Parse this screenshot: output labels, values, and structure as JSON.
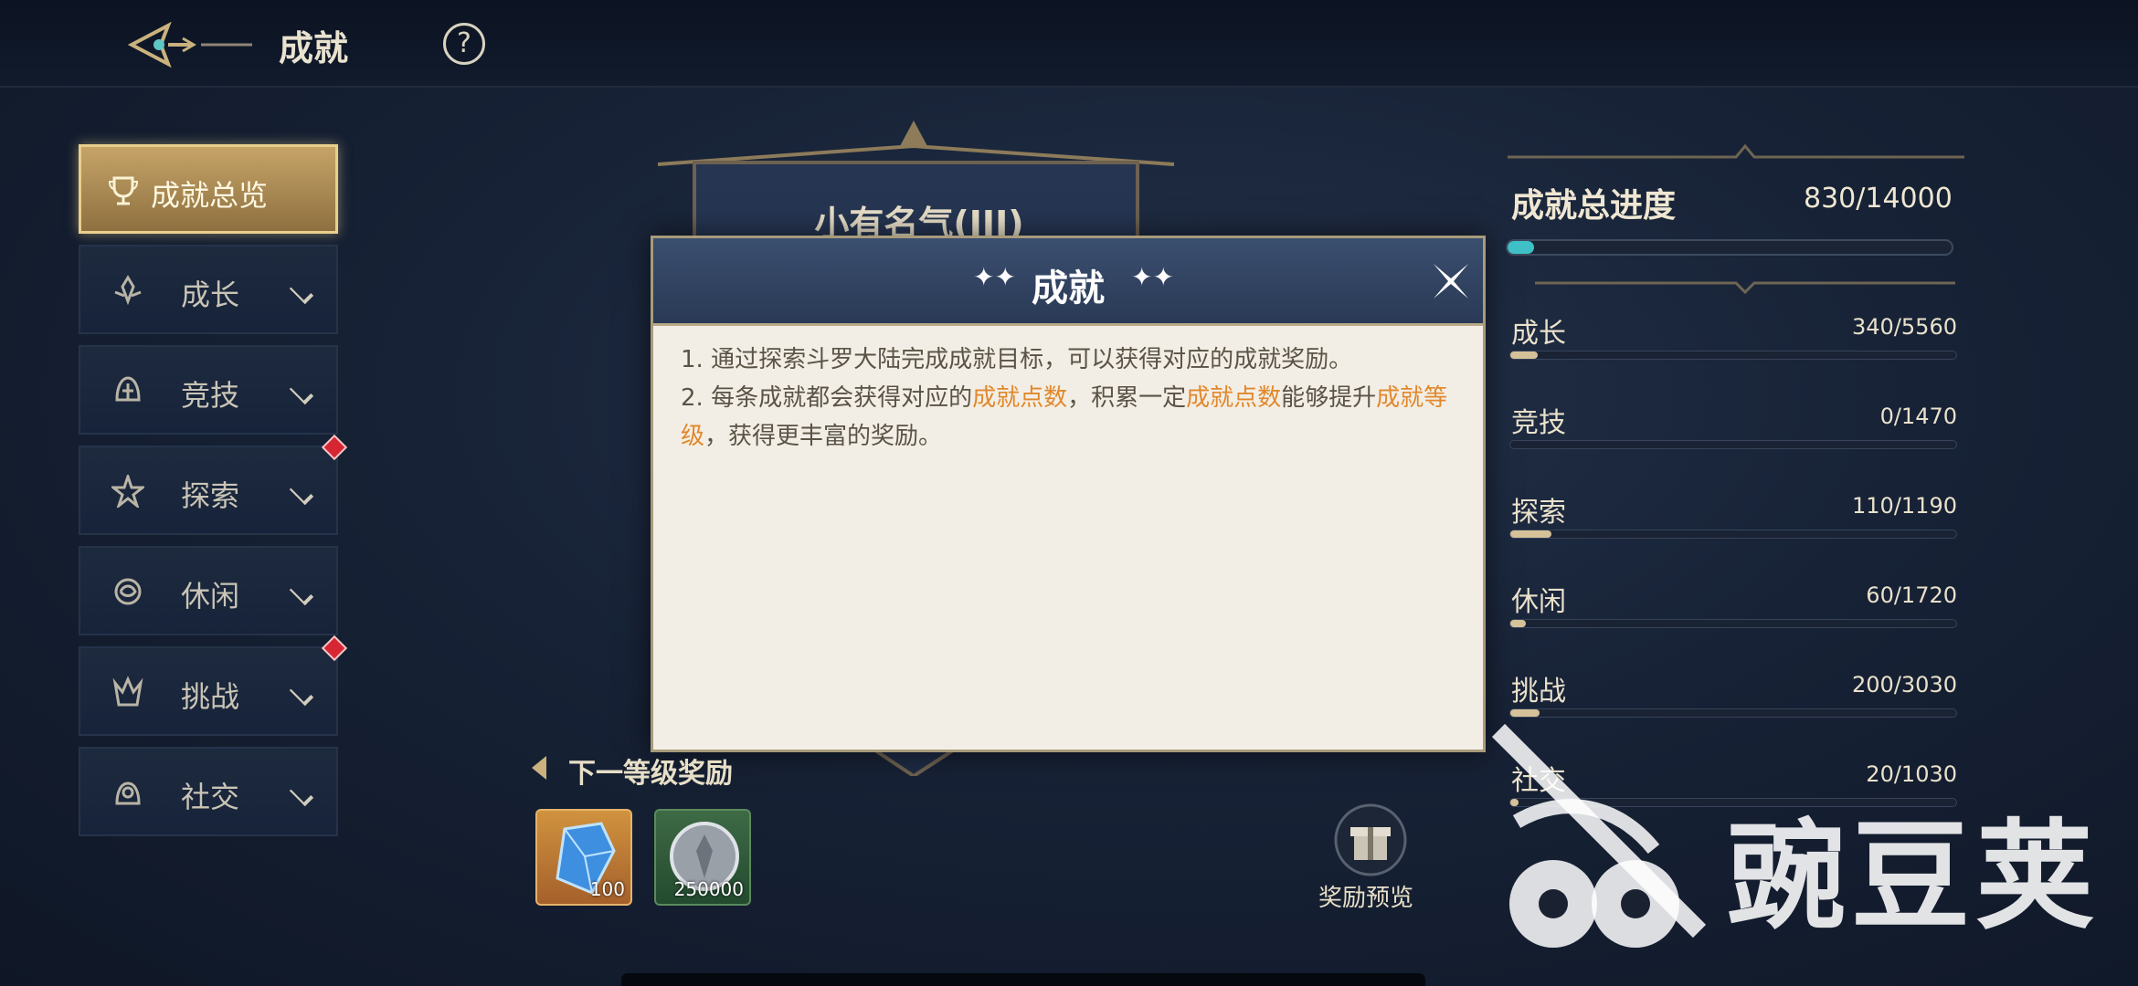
{
  "header": {
    "title": "成就",
    "help_icon": "question-circle-icon",
    "back_icon": "ornate-back-arrow-icon"
  },
  "sidebar": {
    "items": [
      {
        "label": "成就总览",
        "icon": "trophy-icon",
        "active": true,
        "badge": false
      },
      {
        "label": "成长",
        "icon": "sprout-icon",
        "active": false,
        "badge": false
      },
      {
        "label": "竞技",
        "icon": "helmet-icon",
        "active": false,
        "badge": false
      },
      {
        "label": "探索",
        "icon": "compass-star-icon",
        "active": false,
        "badge": true
      },
      {
        "label": "休闲",
        "icon": "leisure-icon",
        "active": false,
        "badge": false
      },
      {
        "label": "挑战",
        "icon": "flame-crest-icon",
        "active": false,
        "badge": true
      },
      {
        "label": "社交",
        "icon": "handshake-icon",
        "active": false,
        "badge": false
      }
    ]
  },
  "banner": {
    "title": "小有名气(III)"
  },
  "dialog": {
    "title": "成就",
    "line1": "1. 通过探索斗罗大陆完成成就目标，可以获得对应的成就奖励。",
    "line2_a": "2. 每条成就都会获得对应的",
    "line2_hl1": "成就点数",
    "line2_b": "，积累一定",
    "line2_hl2": "成就点数",
    "line2_c": "能够提升",
    "line2_hl3": "成就等级",
    "line2_d": "，获得更丰富的奖励。",
    "highlight_color": "#e1882c"
  },
  "rewards": {
    "title": "下一等级奖励",
    "items": [
      {
        "icon": "blue-crystal-icon",
        "count": "100"
      },
      {
        "icon": "silver-coin-icon",
        "count": "250000"
      }
    ],
    "preview_label": "奖励预览",
    "preview_icon": "gift-box-icon"
  },
  "progress": {
    "overall_label": "成就总进度",
    "overall_value": "830/14000",
    "overall_fraction": 0.059,
    "categories": [
      {
        "name": "成长",
        "value": "340/5560",
        "fraction": 0.061
      },
      {
        "name": "竞技",
        "value": "0/1470",
        "fraction": 0.0
      },
      {
        "name": "探索",
        "value": "110/1190",
        "fraction": 0.092
      },
      {
        "name": "休闲",
        "value": "60/1720",
        "fraction": 0.035
      },
      {
        "name": "挑战",
        "value": "200/3030",
        "fraction": 0.066
      },
      {
        "name": "社交",
        "value": "20/1030",
        "fraction": 0.019
      }
    ]
  },
  "watermark": {
    "text": "豌豆荚"
  },
  "colors": {
    "accent_gold": "#c6a468",
    "overall_bar": "#3ec0c6",
    "category_bar": "#d6c298",
    "badge_red": "#d62634"
  }
}
